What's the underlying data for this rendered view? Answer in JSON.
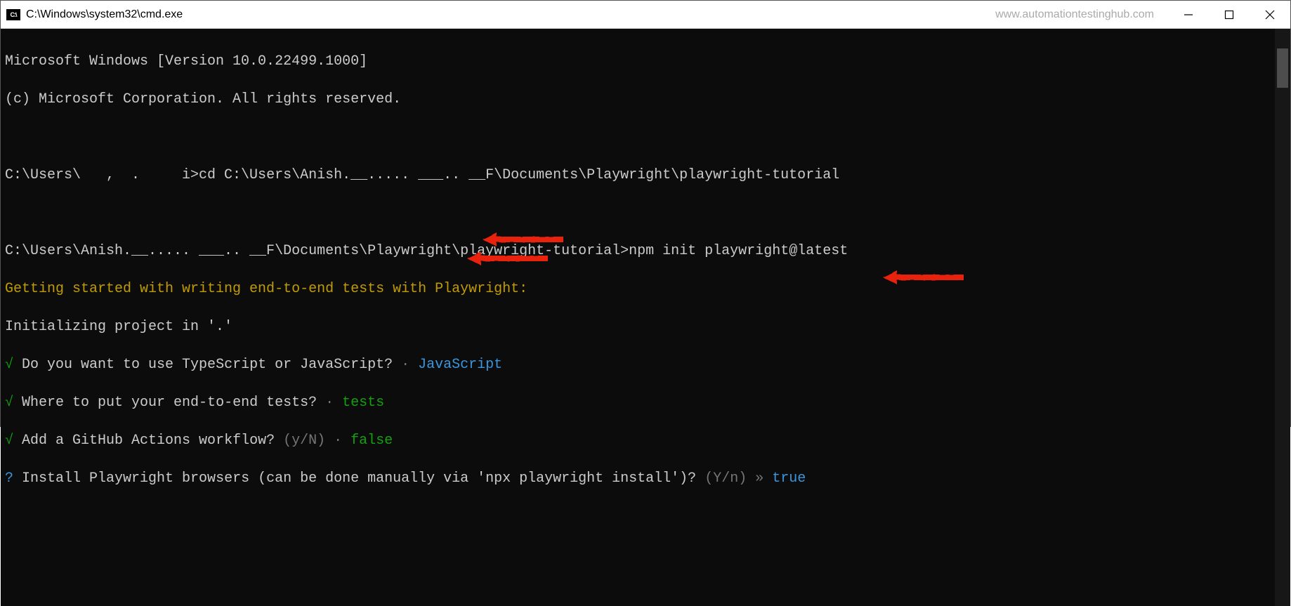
{
  "window": {
    "title": "C:\\Windows\\system32\\cmd.exe",
    "watermark": "www.automationtestinghub.com",
    "icon_label": "C:\\"
  },
  "terminal": {
    "header_line1": "Microsoft Windows [Version 10.0.22499.1000]",
    "header_line2": "(c) Microsoft Corporation. All rights reserved.",
    "prompt1_path": "C:\\Users\\   ,  .     i>",
    "prompt1_cmd": "cd C:\\Users\\Anish.__..... ___.. __F\\Documents\\Playwright\\playwright-tutorial",
    "prompt2_path": "C:\\Users\\Anish.__..... ___.. __F\\Documents\\Playwright\\playwright-tutorial>",
    "prompt2_cmd": "npm init playwright@latest",
    "getting_started": "Getting started with writing end-to-end tests with Playwright:",
    "initializing": "Initializing project in '.'",
    "q1": {
      "check": "√",
      "question": " Do you want to use TypeScript or JavaScript?",
      "sep": " · ",
      "answer": "JavaScript"
    },
    "q2": {
      "check": "√",
      "question": " Where to put your end-to-end tests?",
      "sep": " · ",
      "answer": "tests"
    },
    "q3": {
      "check": "√",
      "question": " Add a GitHub Actions workflow?",
      "hint": " (y/N)",
      "sep": " · ",
      "answer": "false"
    },
    "q4": {
      "prompt": "?",
      "question": " Install Playwright browsers (can be done manually via 'npx playwright install')?",
      "hint": " (Y/n)",
      "sep": " » ",
      "answer": "true"
    }
  }
}
